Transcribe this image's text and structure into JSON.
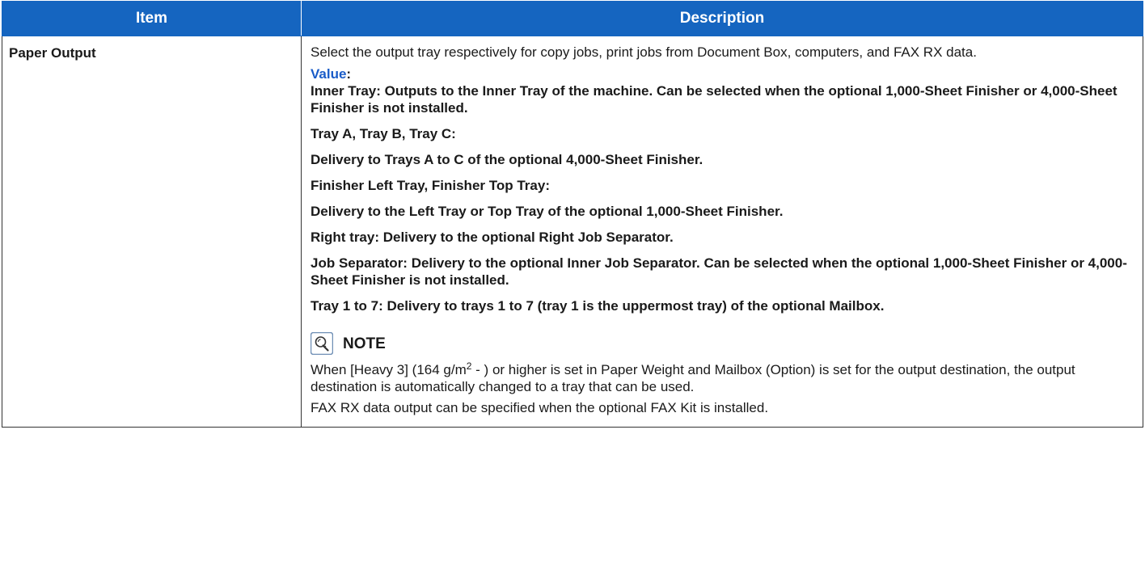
{
  "header": {
    "item": "Item",
    "description": "Description"
  },
  "row": {
    "item": "Paper Output",
    "intro": "Select the output tray respectively for copy jobs, print jobs from Document Box, computers, and FAX RX data.",
    "value_label": "Value",
    "value_colon": ":",
    "values": [
      "Inner Tray: Outputs to the Inner Tray of the machine. Can be selected when the optional 1,000-Sheet Finisher or 4,000-Sheet Finisher is not installed.",
      "Tray A, Tray B, Tray C:",
      "Delivery to Trays A to C of the optional 4,000-Sheet Finisher.",
      "Finisher Left Tray, Finisher Top Tray:",
      "Delivery to the Left Tray or Top Tray of the optional 1,000-Sheet Finisher.",
      "Right tray: Delivery to the optional Right Job Separator.",
      "Job Separator: Delivery to the optional Inner Job Separator. Can be selected when the optional 1,000-Sheet Finisher or 4,000-Sheet Finisher is not installed.",
      "Tray 1 to 7: Delivery to trays 1 to 7 (tray 1 is the uppermost tray) of the optional Mailbox."
    ],
    "note": {
      "title": "NOTE",
      "icon": "note-lightbulb-icon",
      "para1_before": "When [Heavy 3] (164 g/m",
      "para1_sup": "2",
      "para1_after": " - ) or higher is set in Paper Weight and Mailbox (Option) is set for the output destination, the output destination is automatically changed to a tray that can be used.",
      "para2": "FAX RX data output can be specified when the optional FAX Kit is installed."
    }
  },
  "colors": {
    "header_bg": "#1565c0",
    "value_label": "#1a5cc8",
    "border": "#333333"
  }
}
